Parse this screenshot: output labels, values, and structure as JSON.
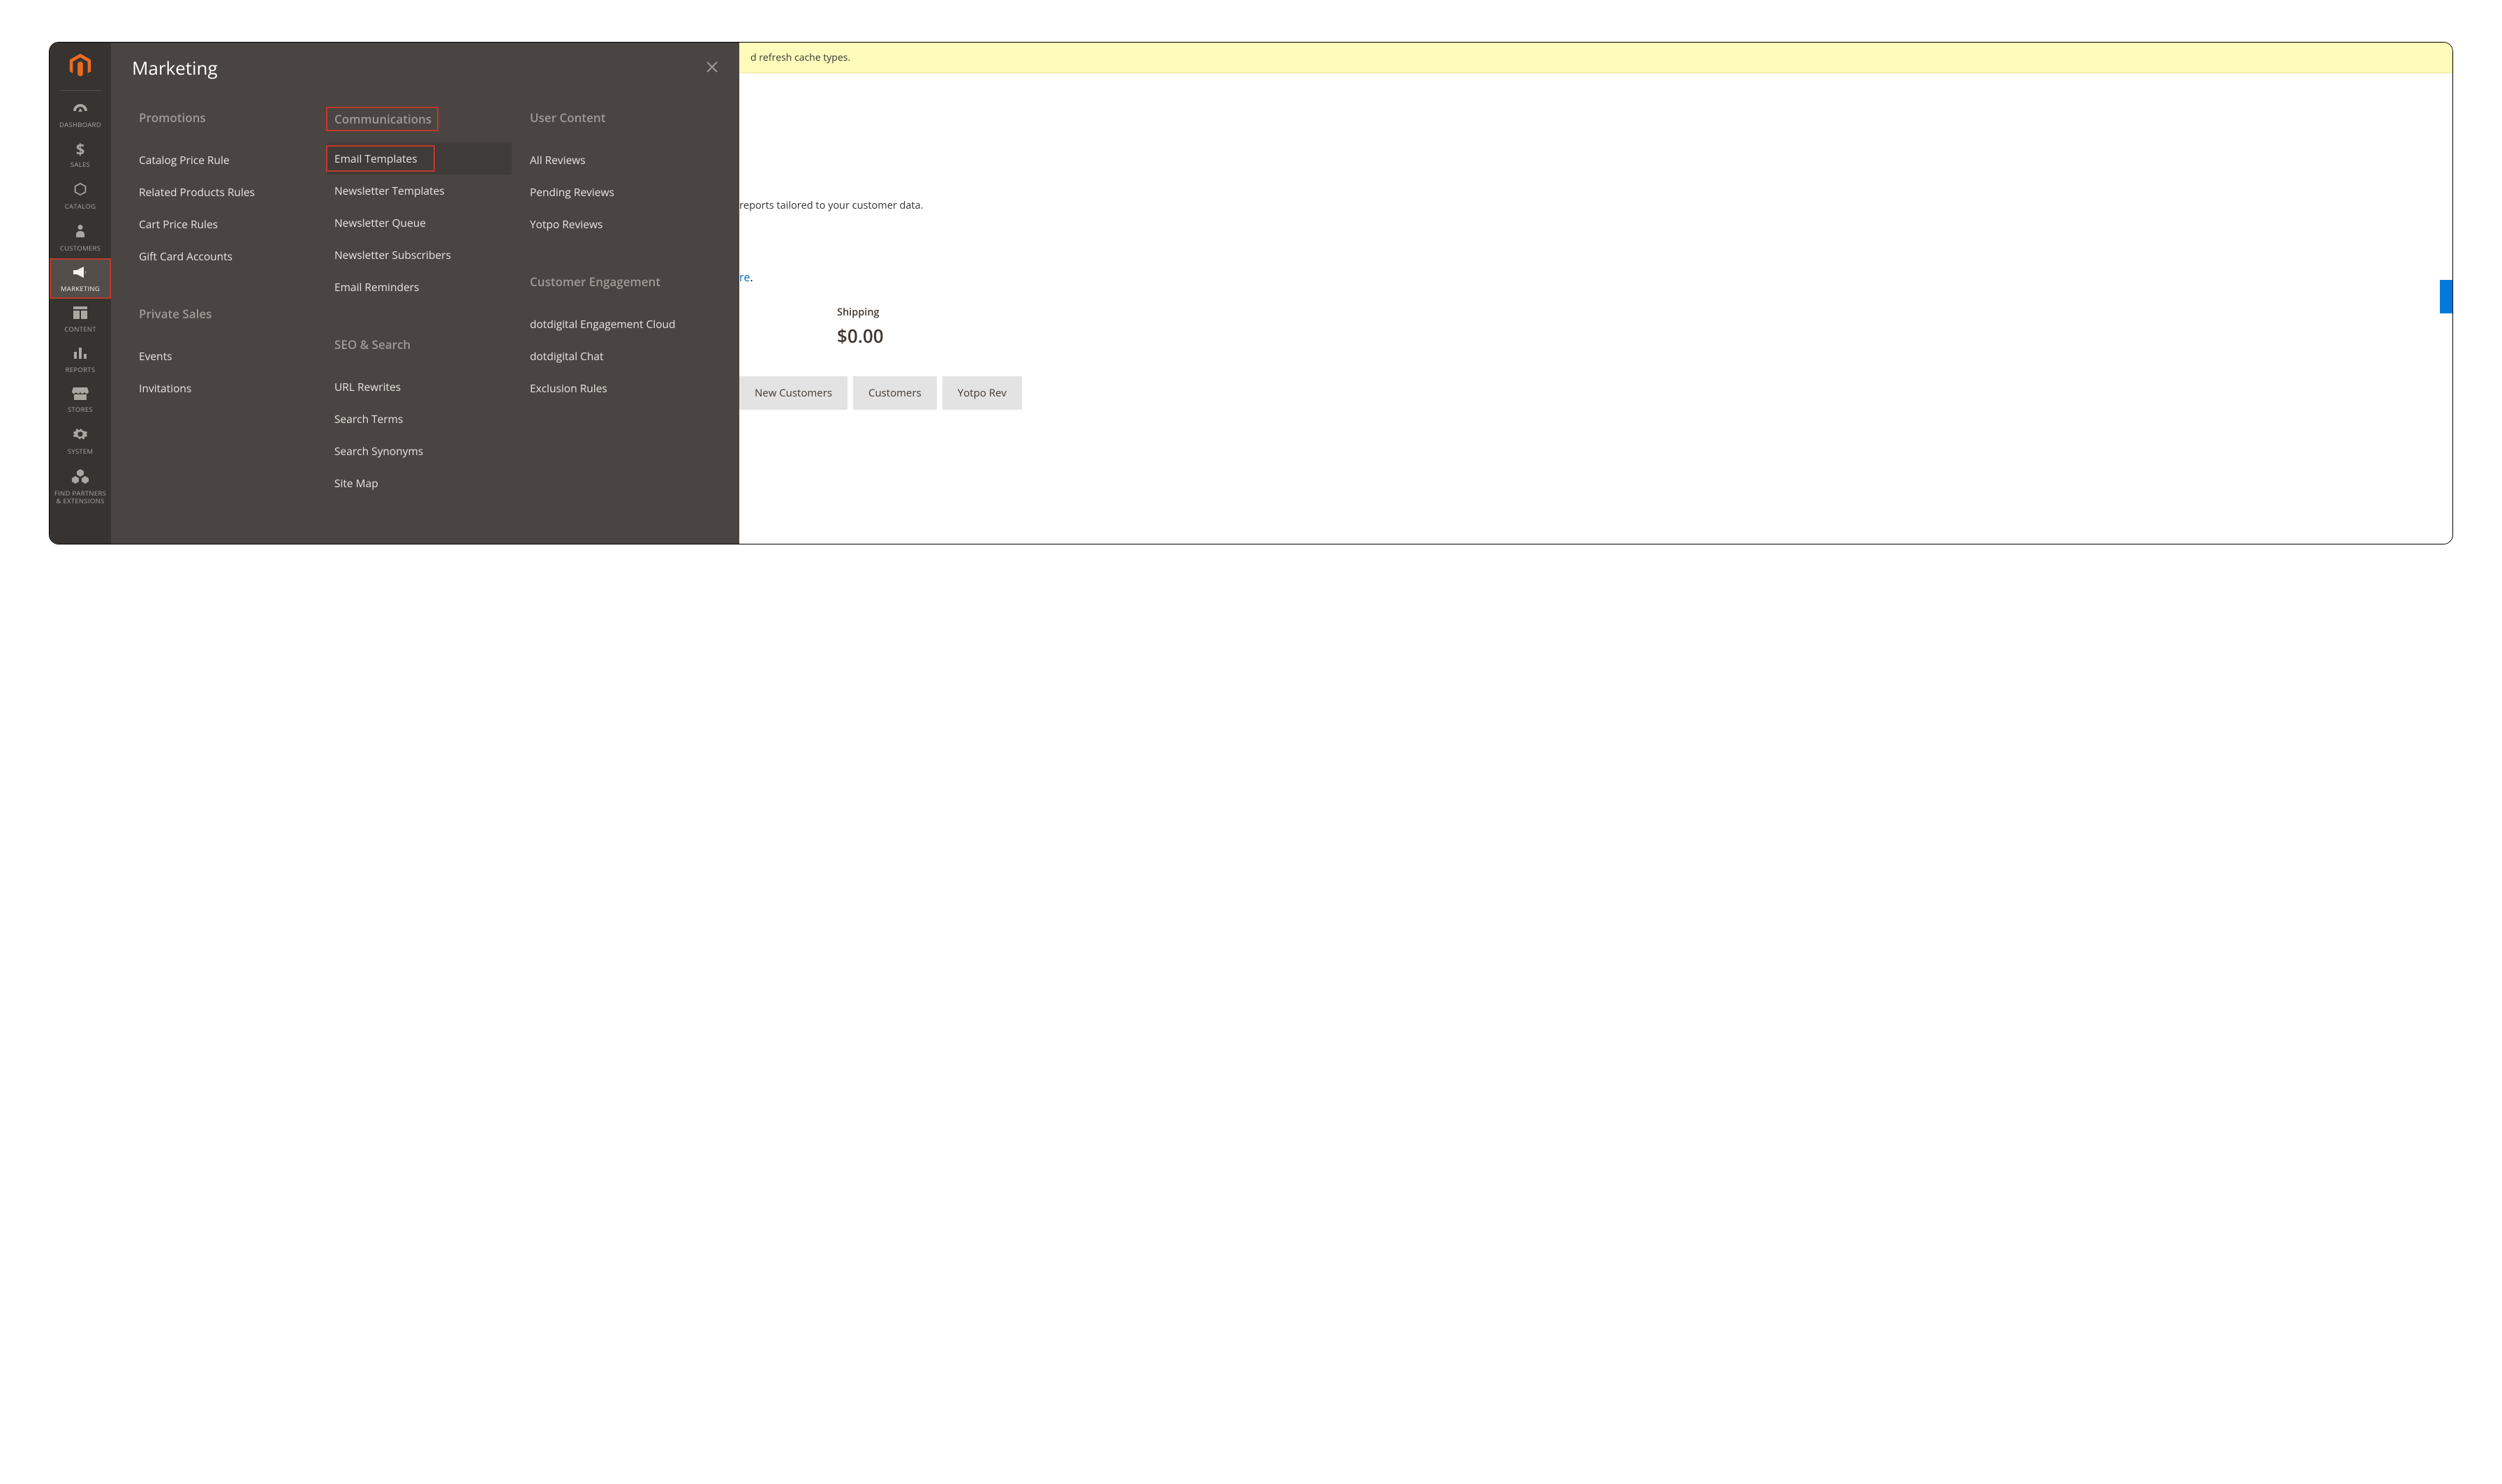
{
  "sidebar": {
    "items": [
      {
        "label": "DASHBOARD",
        "icon": "gauge"
      },
      {
        "label": "SALES",
        "icon": "dollar"
      },
      {
        "label": "CATALOG",
        "icon": "box"
      },
      {
        "label": "CUSTOMERS",
        "icon": "person"
      },
      {
        "label": "MARKETING",
        "icon": "megaphone"
      },
      {
        "label": "CONTENT",
        "icon": "layout"
      },
      {
        "label": "REPORTS",
        "icon": "bars"
      },
      {
        "label": "STORES",
        "icon": "storefront"
      },
      {
        "label": "SYSTEM",
        "icon": "gear"
      },
      {
        "label": "FIND PARTNERS & EXTENSIONS",
        "icon": "cubes"
      }
    ]
  },
  "flyout": {
    "title": "Marketing",
    "columns": [
      {
        "sections": [
          {
            "heading": "Promotions",
            "items": [
              "Catalog Price Rule",
              "Related Products Rules",
              "Cart Price Rules",
              "Gift Card Accounts"
            ]
          },
          {
            "heading": "Private Sales",
            "items": [
              "Events",
              "Invitations"
            ]
          }
        ]
      },
      {
        "sections": [
          {
            "heading": "Communications",
            "items": [
              "Email Templates",
              "Newsletter Templates",
              "Newsletter Queue",
              "Newsletter Subscribers",
              "Email Reminders"
            ]
          },
          {
            "heading": "SEO & Search",
            "items": [
              "URL Rewrites",
              "Search Terms",
              "Search Synonyms",
              "Site Map"
            ]
          }
        ]
      },
      {
        "sections": [
          {
            "heading": "User Content",
            "items": [
              "All Reviews",
              "Pending Reviews",
              "Yotpo Reviews"
            ]
          },
          {
            "heading": "Customer Engagement",
            "items": [
              "dotdigital Engagement Cloud",
              "dotdigital Chat",
              "Exclusion Rules"
            ]
          }
        ]
      }
    ]
  },
  "content": {
    "alert_fragment": "d refresh cache types.",
    "reports_fragment": "reports tailored to your customer data.",
    "learn_more_fragment": "re",
    "learn_more_suffix": ".",
    "stat": {
      "label": "Shipping",
      "value": "$0.00"
    },
    "tabs": [
      "New Customers",
      "Customers",
      "Yotpo Rev"
    ]
  }
}
